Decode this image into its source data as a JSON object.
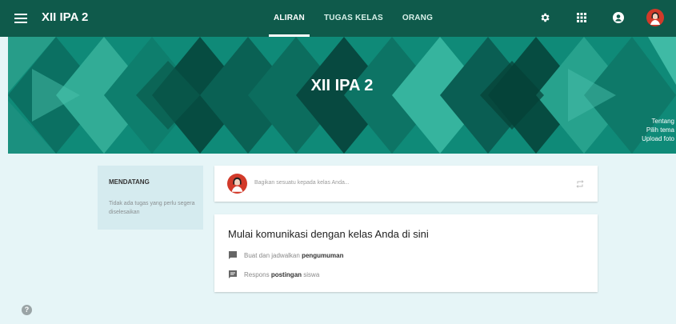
{
  "header": {
    "class_name": "XII IPA 2",
    "tabs": [
      {
        "label": "ALIRAN",
        "active": true
      },
      {
        "label": "TUGAS KELAS",
        "active": false
      },
      {
        "label": "ORANG",
        "active": false
      }
    ],
    "icons": [
      "gear-icon",
      "apps-grid-icon",
      "account-icon",
      "avatar"
    ]
  },
  "banner": {
    "title": "XII IPA 2",
    "links": [
      "Tentang",
      "Pilih tema",
      "Upload foto"
    ]
  },
  "upcoming": {
    "title": "MENDATANG",
    "text": "Tidak ada tugas yang perlu segera diselesaikan"
  },
  "share": {
    "placeholder": "Bagikan sesuatu kepada kelas Anda..."
  },
  "intro": {
    "title": "Mulai komunikasi dengan kelas Anda di sini",
    "row1_prefix": "Buat dan jadwalkan",
    "row1_bold": "pengumuman",
    "row2_prefix": "Respons",
    "row2_bold": "postingan",
    "row2_suffix": "siswa"
  },
  "help": {
    "label": "?"
  },
  "colors": {
    "header": "#0f5a4b",
    "banner": "#0d7a6b",
    "page_bg": "#e6f5f7",
    "avatar_red": "#d23a2a"
  }
}
